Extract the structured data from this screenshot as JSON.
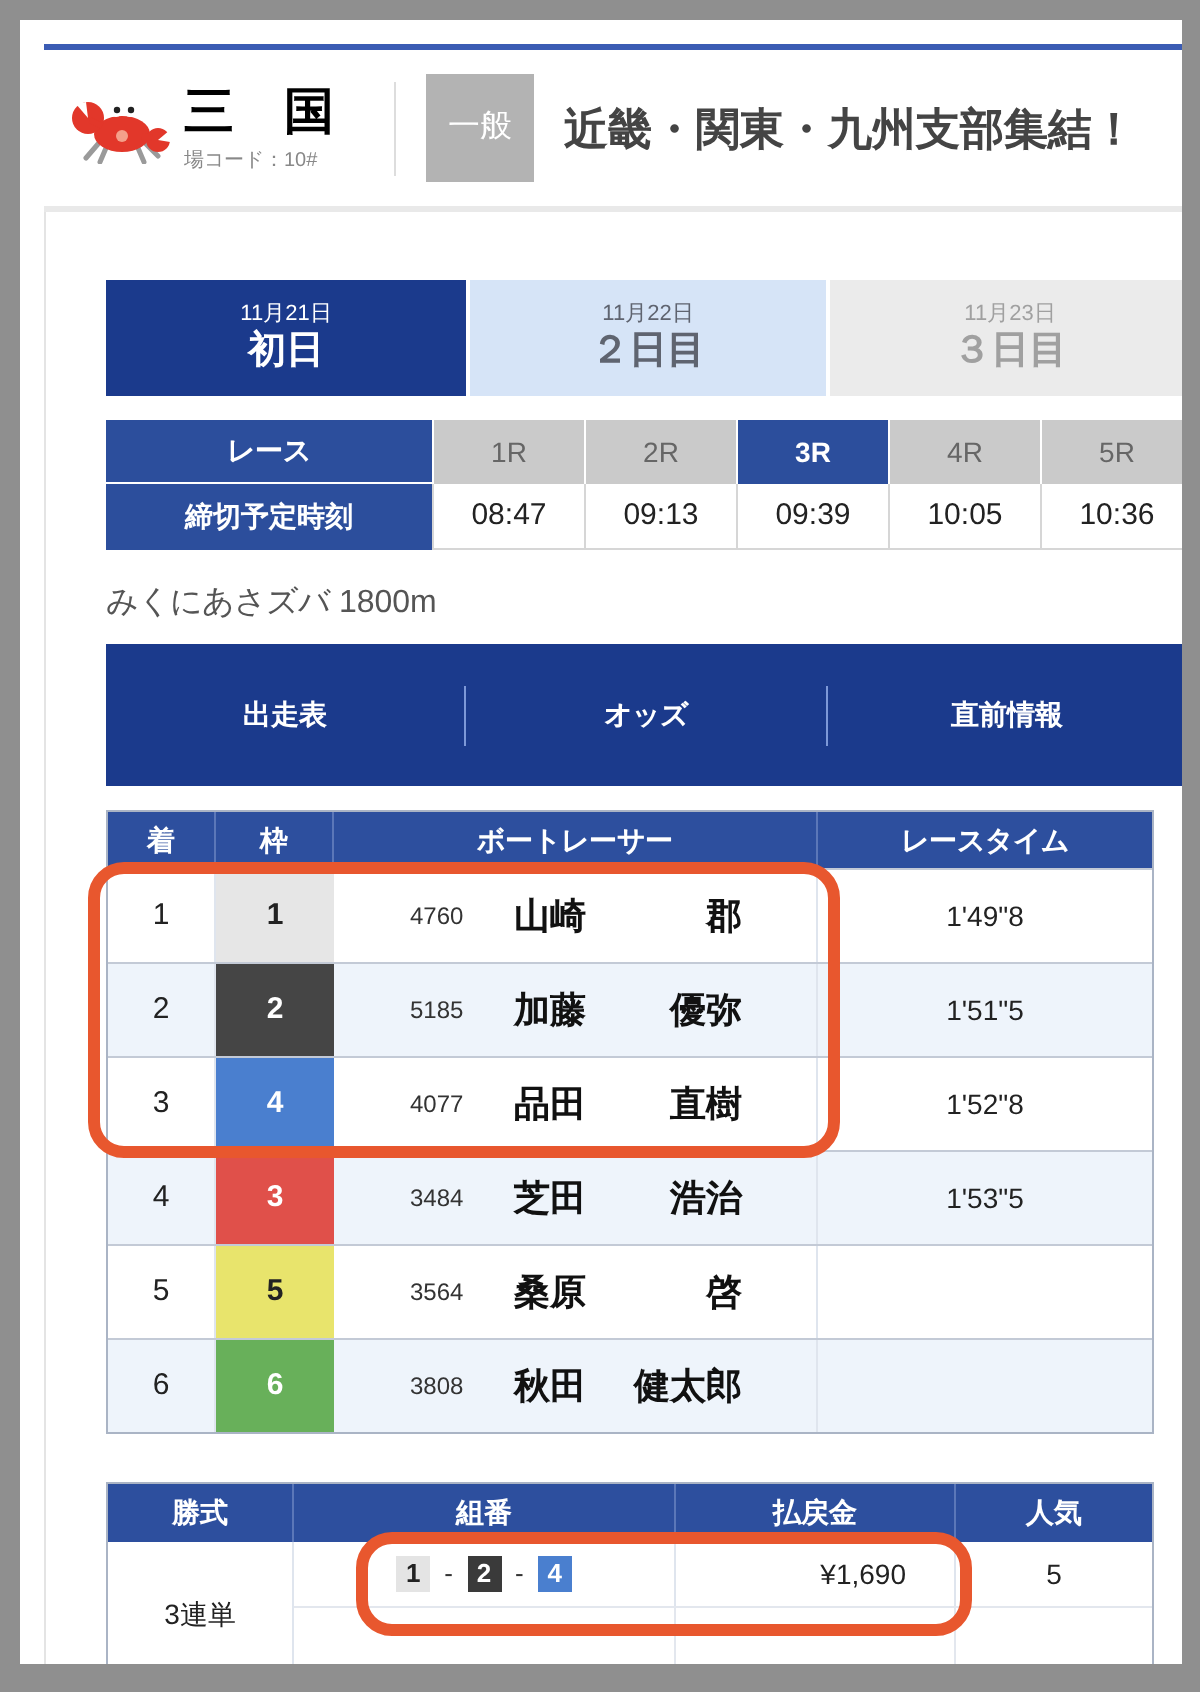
{
  "header": {
    "venue": "三　国",
    "venue_code": "場コード：10#",
    "grade": "一般",
    "title": "近畿・関東・九州支部集結！"
  },
  "day_tabs": [
    {
      "date": "11月21日",
      "label": "初日",
      "selected": true,
      "disabled": false
    },
    {
      "date": "11月22日",
      "label": "２日目",
      "selected": false,
      "disabled": false
    },
    {
      "date": "11月23日",
      "label": "３日目",
      "selected": false,
      "disabled": true
    }
  ],
  "race_table": {
    "race_label": "レース",
    "deadline_label": "締切予定時刻",
    "races": [
      {
        "label": "1R",
        "deadline": "08:47",
        "selected": false
      },
      {
        "label": "2R",
        "deadline": "09:13",
        "selected": false
      },
      {
        "label": "3R",
        "deadline": "09:39",
        "selected": true
      },
      {
        "label": "4R",
        "deadline": "10:05",
        "selected": false
      },
      {
        "label": "5R",
        "deadline": "10:36",
        "selected": false
      }
    ]
  },
  "race_title": "みくにあさズバ 1800m",
  "nav_tabs": [
    {
      "label": "出走表"
    },
    {
      "label": "オッズ"
    },
    {
      "label": "直前情報"
    }
  ],
  "results": {
    "columns": [
      "着",
      "枠",
      "ボートレーサー",
      "レースタイム"
    ],
    "rows": [
      {
        "place": "1",
        "frame": "1",
        "color": "#e6e6e6",
        "reg_no": "4760",
        "surname": "山崎",
        "given_name": "郡",
        "time": "1'49\"8",
        "highlighted": true
      },
      {
        "place": "2",
        "frame": "2",
        "color": "#454545",
        "reg_no": "5185",
        "surname": "加藤",
        "given_name": "優弥",
        "time": "1'51\"5",
        "highlighted": true
      },
      {
        "place": "3",
        "frame": "4",
        "color": "#4a7fcf",
        "reg_no": "4077",
        "surname": "品田",
        "given_name": "直樹",
        "time": "1'52\"8",
        "highlighted": true
      },
      {
        "place": "4",
        "frame": "3",
        "color": "#e0504a",
        "reg_no": "3484",
        "surname": "芝田",
        "given_name": "浩治",
        "time": "1'53\"5",
        "highlighted": false
      },
      {
        "place": "5",
        "frame": "5",
        "color": "#e8e46c",
        "reg_no": "3564",
        "surname": "桑原",
        "given_name": "啓",
        "highlighted": false
      },
      {
        "place": "6",
        "frame": "6",
        "color": "#68b05a",
        "reg_no": "3808",
        "surname": "秋田",
        "given_name": "健太郎",
        "highlighted": false
      }
    ]
  },
  "payouts": {
    "columns": [
      "勝式",
      "組番",
      "払戻金",
      "人気"
    ],
    "rows": [
      {
        "bet_type": "3連単",
        "combination": [
          {
            "kind": "frame",
            "number": "1",
            "color": "#e4e4e4"
          },
          {
            "kind": "separator",
            "text": "-"
          },
          {
            "kind": "frame",
            "number": "2",
            "color": "#3a3a3a"
          },
          {
            "kind": "separator",
            "text": "-"
          },
          {
            "kind": "frame",
            "number": "4",
            "color": "#4a7fcf"
          }
        ],
        "payout": "¥1,690",
        "popularity": "5",
        "highlighted": true
      }
    ]
  }
}
